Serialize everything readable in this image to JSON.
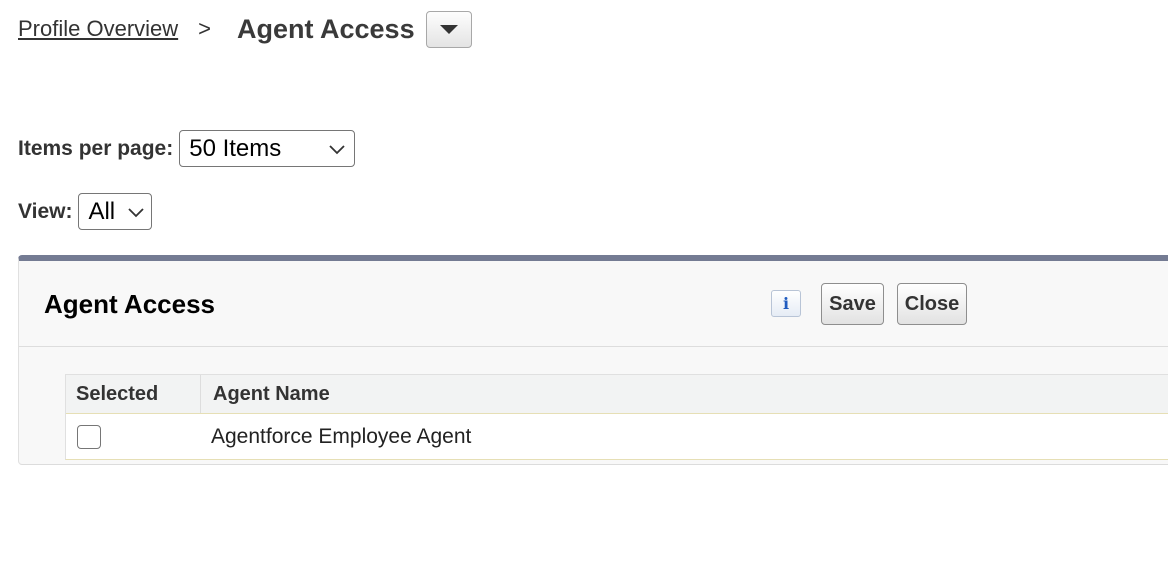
{
  "breadcrumb": {
    "parent_label": "Profile Overview",
    "separator": ">",
    "current_label": "Agent Access"
  },
  "filters": {
    "items_per_page_label": "Items per page:",
    "items_per_page_value": "50 Items",
    "view_label": "View:",
    "view_value": "All"
  },
  "panel": {
    "title": "Agent Access",
    "info_icon": "i",
    "save_label": "Save",
    "close_label": "Close"
  },
  "table": {
    "columns": [
      "Selected",
      "Agent Name"
    ],
    "rows": [
      {
        "selected": false,
        "agent_name": "Agentforce Employee Agent"
      }
    ]
  },
  "colors": {
    "panel_accent": "#747b93",
    "info_icon": "#1f5bbf"
  }
}
